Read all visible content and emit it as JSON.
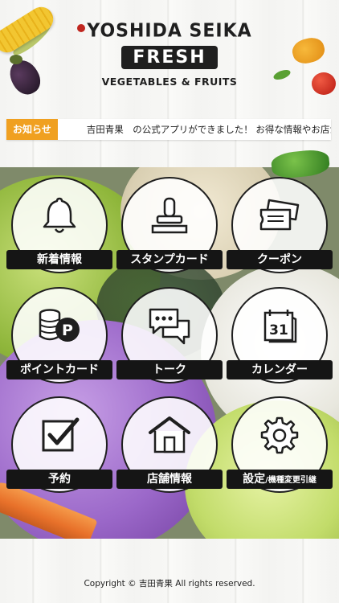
{
  "header": {
    "brand_top": "YOSHIDA SEIKA",
    "brand_fresh": "FRESH",
    "brand_sub": "VEGETABLES & FRUITS"
  },
  "notice": {
    "badge": "お知らせ",
    "text": "吉田青果　の公式アプリができました！ お得な情報やお店からのお知らせ"
  },
  "menu": [
    {
      "label": "新着情報",
      "icon": "bell-icon"
    },
    {
      "label": "スタンプカード",
      "icon": "stamp-icon"
    },
    {
      "label": "クーポン",
      "icon": "coupon-icon"
    },
    {
      "label": "ポイントカード",
      "icon": "coins-icon"
    },
    {
      "label": "トーク",
      "icon": "chat-bubbles-icon"
    },
    {
      "label": "カレンダー",
      "icon": "calendar-icon"
    },
    {
      "label": "予約",
      "icon": "checkbox-icon"
    },
    {
      "label": "店舗情報",
      "icon": "house-icon"
    },
    {
      "label_main": "設定",
      "label_sub": "/機種変更引継",
      "icon": "gear-icon"
    }
  ],
  "calendar_day": "31",
  "point_symbol": "P",
  "footer": {
    "copyright": "Copyright © 吉田青果 All rights reserved."
  },
  "colors": {
    "badge": "#f0a020",
    "label_bg": "#151515"
  }
}
